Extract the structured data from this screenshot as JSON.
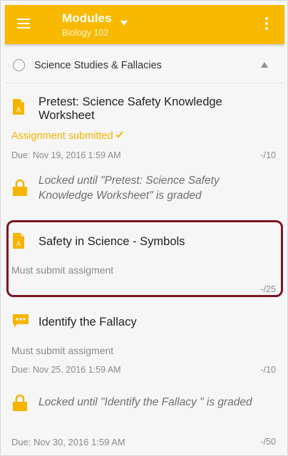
{
  "appbar": {
    "title": "Modules",
    "subtitle": "Biology 102"
  },
  "module": {
    "name": "Science Studies & Fallacies"
  },
  "items": [
    {
      "title_line1": "Pretest: Science Safety Knowledge",
      "title_line2": "Worksheet",
      "status": "Assignment submitted",
      "due": "Due: Nov 19, 2016 1:59 AM",
      "points": "-/10",
      "icon": "assignment-icon"
    },
    {
      "locked_line1": "Locked until \"Pretest: Science Safety",
      "locked_line2": "Knowledge Worksheet\" is graded",
      "icon": "lock-icon"
    },
    {
      "title_line1": "Safety in Science - Symbols",
      "requirement": "Must submit assigment",
      "points": "-/25",
      "icon": "assignment-icon"
    },
    {
      "title_line1": "Identify the Fallacy",
      "requirement": "Must submit assigment",
      "due": "Due: Nov 25, 2016 1:59 AM",
      "points": "-/10",
      "icon": "discussion-icon"
    },
    {
      "locked_line1": "Locked until \"Identify the Fallacy \" is graded",
      "icon": "lock-icon"
    },
    {
      "due": "Due: Nov 30, 2016 1:59 AM",
      "points": "-/50"
    }
  ],
  "colors": {
    "accent": "#f9b900",
    "highlight": "#7a1524"
  }
}
